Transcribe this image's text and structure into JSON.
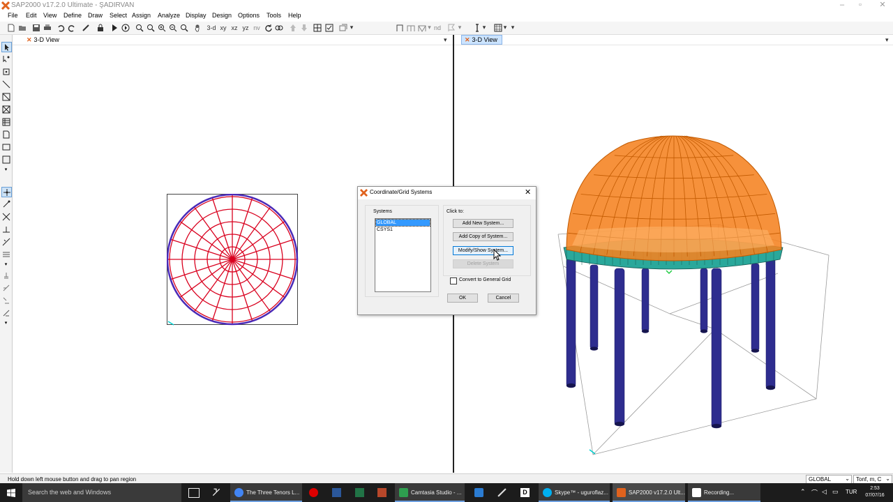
{
  "window": {
    "title": "SAP2000 v17.2.0 Ultimate - ŞADIRVAN"
  },
  "menu": [
    "File",
    "Edit",
    "View",
    "Define",
    "Draw",
    "Select",
    "Assign",
    "Analyze",
    "Display",
    "Design",
    "Options",
    "Tools",
    "Help"
  ],
  "toolbar": {
    "view_3d": "3-d",
    "view_xy": "xy",
    "view_xz": "xz",
    "view_yz": "yz",
    "view_nv": "nv",
    "nd": "nd"
  },
  "panes": {
    "left_tab": "3-D View",
    "right_tab": "3-D View"
  },
  "dialog": {
    "title": "Coordinate/Grid Systems",
    "systems_label": "Systems",
    "systems": [
      "GLOBAL",
      "CSYS1"
    ],
    "selected_system": "GLOBAL",
    "click_to_label": "Click to:",
    "add_new": "Add New System...",
    "add_copy": "Add Copy of System...",
    "modify_show": "Modify/Show System...",
    "delete": "Delete System",
    "convert_label": "Convert to General Grid",
    "convert_checked": false,
    "ok": "OK",
    "cancel": "Cancel"
  },
  "status": {
    "message": "Hold down left mouse button and drag to pan region",
    "coord_system": "GLOBAL",
    "units": "Tonf, m, C"
  },
  "taskbar": {
    "search": "Search the web and Windows",
    "apps": [
      {
        "label": "The Three Tenors L...",
        "color": "#4285f4"
      },
      {
        "label": "Camtasia Studio - ...",
        "color": "#2e9e4f"
      },
      {
        "label": "Skype™ - uguroflaz...",
        "color": "#00aff0"
      },
      {
        "label": "SAP2000 v17.2.0 Ult...",
        "color": "#e0621d"
      },
      {
        "label": "Recording...",
        "color": "#ffffff"
      }
    ],
    "lang": "TUR",
    "time": "2:53",
    "date": "07/07/16"
  },
  "colors": {
    "grid_red": "#d9001e",
    "dome_orange": "#f58220",
    "ring_teal": "#2aa89b",
    "column_blue": "#2e2d8f",
    "selection_blue": "#3399ff"
  }
}
